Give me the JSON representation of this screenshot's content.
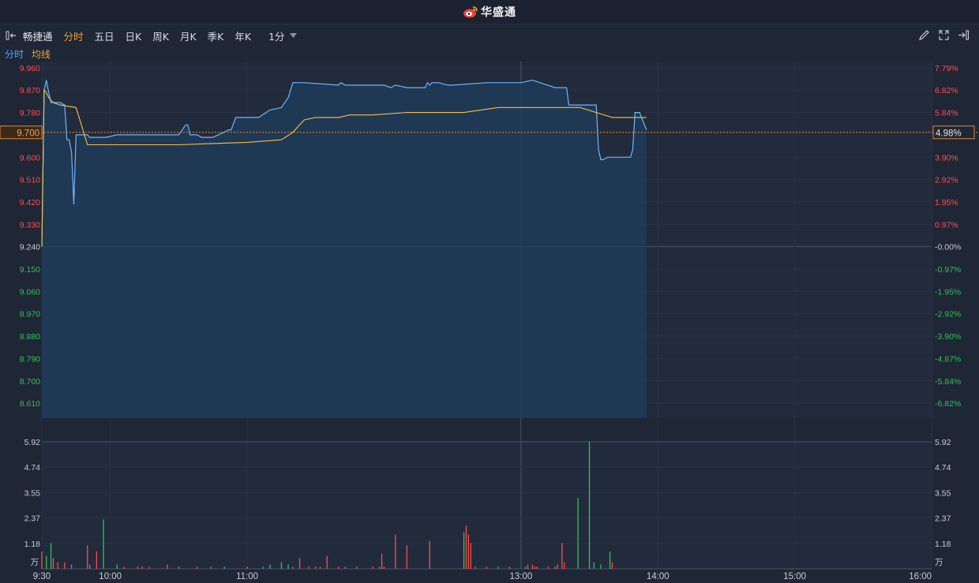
{
  "header": {
    "brand": "华盛通",
    "brand_color": "#e8403a"
  },
  "toolbar": {
    "stock_name": "畅捷通",
    "tabs": [
      {
        "label": "分时",
        "active": true
      },
      {
        "label": "五日",
        "active": false
      },
      {
        "label": "日K",
        "active": false
      },
      {
        "label": "周K",
        "active": false
      },
      {
        "label": "月K",
        "active": false
      },
      {
        "label": "季K",
        "active": false
      },
      {
        "label": "年K",
        "active": false
      }
    ],
    "period": "1分",
    "icons": [
      "draw-icon",
      "fullscreen-icon",
      "exit-icon"
    ]
  },
  "legend": {
    "price": "分时",
    "avg": "均线"
  },
  "colors": {
    "price_line": "#6cb6ff",
    "avg_line": "#f5c042",
    "up": "#ff4d4f",
    "down": "#2fc25b",
    "neutral": "#c8ccd4"
  },
  "chart_data": {
    "type": "line",
    "prev_close": 9.24,
    "price_axis": {
      "ticks": [
        "9.960",
        "9.870",
        "9.780",
        "9.700",
        "9.600",
        "9.510",
        "9.420",
        "9.330",
        "9.240",
        "9.150",
        "9.060",
        "8.970",
        "8.880",
        "8.790",
        "8.700",
        "8.610"
      ],
      "pct_ticks": [
        "7.79%",
        "6.82%",
        "5.84%",
        "4.98%",
        "3.90%",
        "2.92%",
        "1.95%",
        "0.97%",
        "-0.00%",
        "-0.97%",
        "-1.95%",
        "-2.92%",
        "-3.90%",
        "-4.87%",
        "-5.84%",
        "-6.82%"
      ],
      "current_price": "9.700",
      "current_pct": "4.98%",
      "ylim": [
        8.55,
        9.985
      ]
    },
    "time_axis": {
      "labels": [
        "9:30",
        "10:00",
        "11:00",
        "13:00",
        "14:00",
        "15:00",
        "16:00"
      ]
    },
    "volume_axis": {
      "ticks": [
        "5.92",
        "4.74",
        "3.55",
        "2.37",
        "1.18"
      ],
      "unit": "万",
      "ylim": [
        0,
        5.92
      ]
    },
    "series": [
      {
        "name": "分时",
        "x": [
          0,
          1,
          2,
          3,
          4,
          8,
          10,
          11,
          12,
          13,
          14,
          15,
          17,
          20,
          21,
          28,
          33,
          35,
          36,
          40,
          42,
          60,
          63,
          64,
          65,
          66,
          68,
          70,
          75,
          82,
          83,
          85,
          95,
          100,
          105,
          108,
          110,
          115,
          130,
          131,
          133,
          150,
          153,
          155,
          160,
          168,
          169,
          170,
          171,
          174,
          178,
          180,
          195,
          200,
          210,
          215,
          225,
          230,
          231,
          235,
          238,
          243,
          244,
          245,
          246,
          248,
          252,
          258,
          259,
          260,
          261,
          262,
          265
        ],
        "y": [
          9.24,
          9.87,
          9.91,
          9.86,
          9.82,
          9.82,
          9.81,
          9.67,
          9.67,
          9.62,
          9.41,
          9.69,
          9.69,
          9.69,
          9.68,
          9.68,
          9.69,
          9.69,
          9.69,
          9.69,
          9.69,
          9.69,
          9.73,
          9.73,
          9.69,
          9.69,
          9.69,
          9.68,
          9.68,
          9.71,
          9.71,
          9.76,
          9.76,
          9.79,
          9.8,
          9.84,
          9.9,
          9.9,
          9.89,
          9.9,
          9.89,
          9.89,
          9.88,
          9.89,
          9.88,
          9.88,
          9.9,
          9.89,
          9.9,
          9.9,
          9.89,
          9.89,
          9.9,
          9.9,
          9.9,
          9.91,
          9.88,
          9.88,
          9.81,
          9.81,
          9.81,
          9.81,
          9.63,
          9.59,
          9.59,
          9.6,
          9.6,
          9.6,
          9.63,
          9.78,
          9.78,
          9.78,
          9.71
        ]
      },
      {
        "name": "均线",
        "x": [
          0,
          1,
          2,
          3,
          5,
          8,
          15,
          17,
          20,
          30,
          60,
          75,
          90,
          105,
          110,
          115,
          120,
          130,
          135,
          145,
          160,
          185,
          200,
          225,
          236,
          250,
          265
        ],
        "y": [
          9.24,
          9.87,
          9.86,
          9.84,
          9.82,
          9.81,
          9.8,
          9.74,
          9.65,
          9.65,
          9.65,
          9.655,
          9.66,
          9.67,
          9.7,
          9.75,
          9.76,
          9.76,
          9.77,
          9.77,
          9.78,
          9.78,
          9.8,
          9.8,
          9.8,
          9.76,
          9.76
        ]
      }
    ],
    "volume": {
      "x": [
        0,
        2,
        4,
        5,
        7,
        10,
        13,
        20,
        21,
        24,
        27,
        33,
        36,
        42,
        44,
        47,
        55,
        60,
        68,
        74,
        80,
        90,
        97,
        100,
        105,
        108,
        110,
        113,
        117,
        120,
        122,
        125,
        130,
        133,
        138,
        145,
        148,
        149,
        150,
        155,
        160,
        170,
        185,
        186,
        187,
        188,
        190,
        195,
        200,
        205,
        212,
        213,
        215,
        216,
        217,
        222,
        225,
        226,
        228,
        229,
        235,
        240,
        242,
        245,
        249,
        250
      ],
      "v": [
        0.8,
        0.6,
        1.2,
        0.5,
        0.3,
        0.3,
        0.2,
        1.1,
        0.2,
        0.8,
        2.3,
        0.2,
        0.1,
        0.1,
        0.1,
        0.1,
        0.2,
        0.1,
        0.1,
        0.1,
        0.1,
        0.1,
        0.1,
        0.2,
        0.3,
        0.2,
        0.1,
        0.5,
        0.1,
        0.1,
        0.1,
        0.6,
        0.1,
        0.1,
        0.1,
        0.1,
        0.1,
        0.7,
        0.1,
        1.6,
        1.1,
        1.3,
        1.7,
        2.0,
        1.6,
        1.2,
        0.1,
        0.1,
        0.1,
        0.1,
        0.1,
        0.2,
        0.2,
        0.1,
        0.1,
        0.1,
        0.1,
        0.2,
        1.2,
        0.3,
        3.3,
        0.1,
        0.3,
        0.2,
        0.8,
        0.3
      ],
      "dir": [
        "u",
        "d",
        "d",
        "u",
        "u",
        "u",
        "u",
        "u",
        "u",
        "u",
        "d",
        "d",
        "u",
        "u",
        "u",
        "u",
        "u",
        "d",
        "u",
        "d",
        "d",
        "u",
        "d",
        "d",
        "d",
        "d",
        "u",
        "u",
        "u",
        "u",
        "u",
        "u",
        "u",
        "u",
        "d",
        "u",
        "u",
        "u",
        "u",
        "u",
        "u",
        "u",
        "d",
        "u",
        "u",
        "u",
        "u",
        "u",
        "d",
        "u",
        "u",
        "u",
        "u",
        "u",
        "u",
        "u",
        "u",
        "u",
        "u",
        "u",
        "d",
        "d",
        "d",
        "d",
        "d",
        "u"
      ]
    },
    "volume_extra": {
      "x": [
        240
      ],
      "v": [
        5.92
      ],
      "dir": [
        "d"
      ]
    },
    "grid": true
  }
}
